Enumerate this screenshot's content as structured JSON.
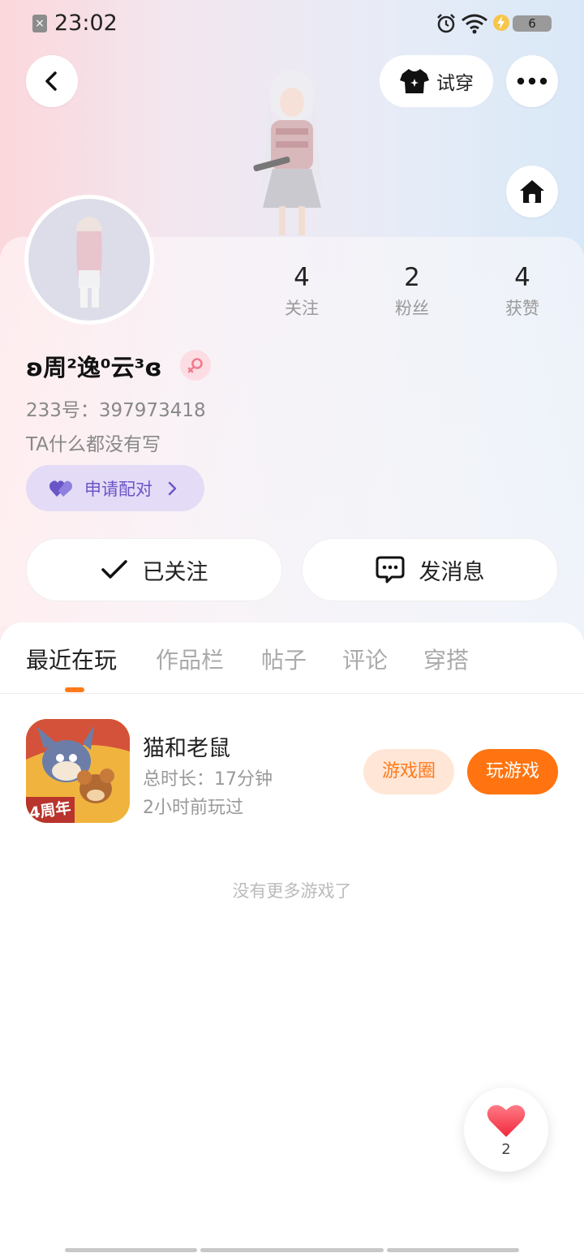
{
  "status_bar": {
    "time": "23:02",
    "battery": "6",
    "notif_icon": "x-notification-icon"
  },
  "header": {
    "tryon_label": "试穿"
  },
  "profile": {
    "stats": [
      {
        "value": "4",
        "label": "关注"
      },
      {
        "value": "2",
        "label": "粉丝"
      },
      {
        "value": "4",
        "label": "获赞"
      }
    ],
    "username": "ʚ周²逸⁰云³ɞ",
    "uid": "233号：397973418",
    "bio": "TA什么都没有写",
    "match_label": "申请配对"
  },
  "actions": {
    "followed_label": "已关注",
    "message_label": "发消息"
  },
  "tabs": [
    "最近在玩",
    "作品栏",
    "帖子",
    "评论",
    "穿搭"
  ],
  "game": {
    "name": "猫和老鼠",
    "play_time": "总时长：17分钟",
    "last_played": "2小时前玩过",
    "icon_badge": "4周年",
    "circle_label": "游戏圈",
    "play_label": "玩游戏"
  },
  "no_more": "没有更多游戏了",
  "like": {
    "count": "2"
  },
  "colors": {
    "accent": "#ff7410",
    "match_purple": "#6a55c8"
  }
}
